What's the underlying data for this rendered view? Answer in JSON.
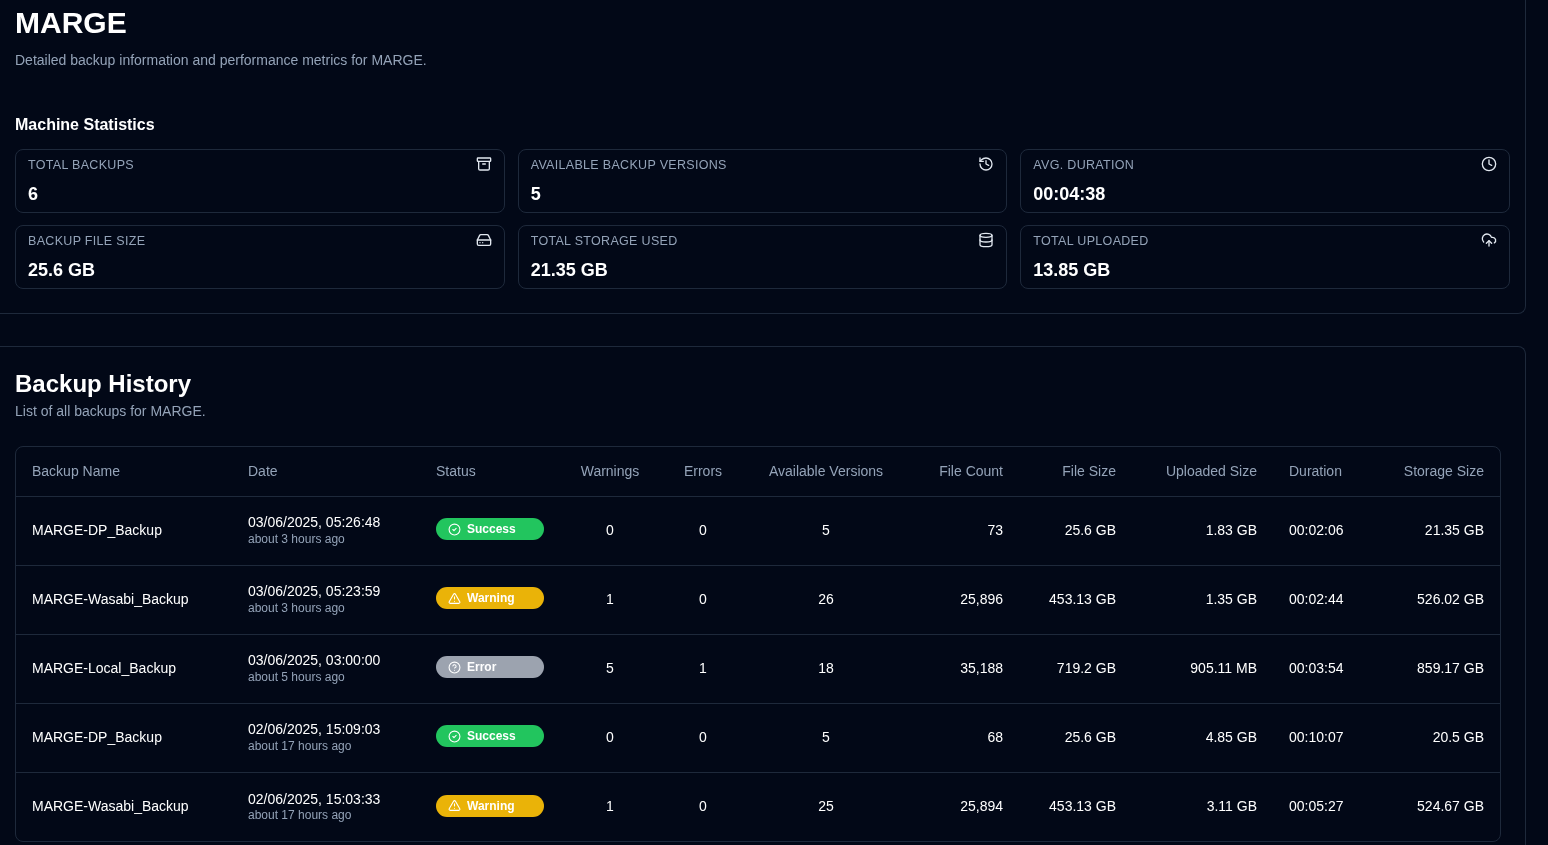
{
  "header": {
    "title": "MARGE",
    "subtitle": "Detailed backup information and performance metrics for MARGE."
  },
  "statistics": {
    "title": "Machine Statistics",
    "cards": [
      {
        "label": "TOTAL BACKUPS",
        "value": "6",
        "kind": "archive"
      },
      {
        "label": "AVAILABLE BACKUP VERSIONS",
        "value": "5",
        "kind": "history"
      },
      {
        "label": "AVG. DURATION",
        "value": "00:04:38",
        "kind": "clock"
      },
      {
        "label": "BACKUP FILE SIZE",
        "value": "25.6 GB",
        "kind": "drive"
      },
      {
        "label": "TOTAL STORAGE USED",
        "value": "21.35 GB",
        "kind": "database"
      },
      {
        "label": "TOTAL UPLOADED",
        "value": "13.85 GB",
        "kind": "upload"
      }
    ]
  },
  "history": {
    "title": "Backup History",
    "subtitle": "List of all backups for MARGE.",
    "columns": [
      "Backup Name",
      "Date",
      "Status",
      "Warnings",
      "Errors",
      "Available Versions",
      "File Count",
      "File Size",
      "Uploaded Size",
      "Duration",
      "Storage Size"
    ],
    "rows": [
      {
        "name": "MARGE-DP_Backup",
        "date": "03/06/2025, 05:26:48",
        "ago": "about 3 hours ago",
        "status": "Success",
        "kind": "success",
        "warnings": "0",
        "errors": "0",
        "versions": "5",
        "file_count": "73",
        "file_size": "25.6 GB",
        "uploaded": "1.83 GB",
        "duration": "00:02:06",
        "storage": "21.35 GB"
      },
      {
        "name": "MARGE-Wasabi_Backup",
        "date": "03/06/2025, 05:23:59",
        "ago": "about 3 hours ago",
        "status": "Warning",
        "kind": "warning",
        "warnings": "1",
        "errors": "0",
        "versions": "26",
        "file_count": "25,896",
        "file_size": "453.13 GB",
        "uploaded": "1.35 GB",
        "duration": "00:02:44",
        "storage": "526.02 GB"
      },
      {
        "name": "MARGE-Local_Backup",
        "date": "03/06/2025, 03:00:00",
        "ago": "about 5 hours ago",
        "status": "Error",
        "kind": "error",
        "warnings": "5",
        "errors": "1",
        "versions": "18",
        "file_count": "35,188",
        "file_size": "719.2 GB",
        "uploaded": "905.11 MB",
        "duration": "00:03:54",
        "storage": "859.17 GB"
      },
      {
        "name": "MARGE-DP_Backup",
        "date": "02/06/2025, 15:09:03",
        "ago": "about 17 hours ago",
        "status": "Success",
        "kind": "success",
        "warnings": "0",
        "errors": "0",
        "versions": "5",
        "file_count": "68",
        "file_size": "25.6 GB",
        "uploaded": "4.85 GB",
        "duration": "00:10:07",
        "storage": "20.5 GB"
      },
      {
        "name": "MARGE-Wasabi_Backup",
        "date": "02/06/2025, 15:03:33",
        "ago": "about 17 hours ago",
        "status": "Warning",
        "kind": "warning",
        "warnings": "1",
        "errors": "0",
        "versions": "25",
        "file_count": "25,894",
        "file_size": "453.13 GB",
        "uploaded": "3.11 GB",
        "duration": "00:05:27",
        "storage": "524.67 GB"
      }
    ]
  }
}
